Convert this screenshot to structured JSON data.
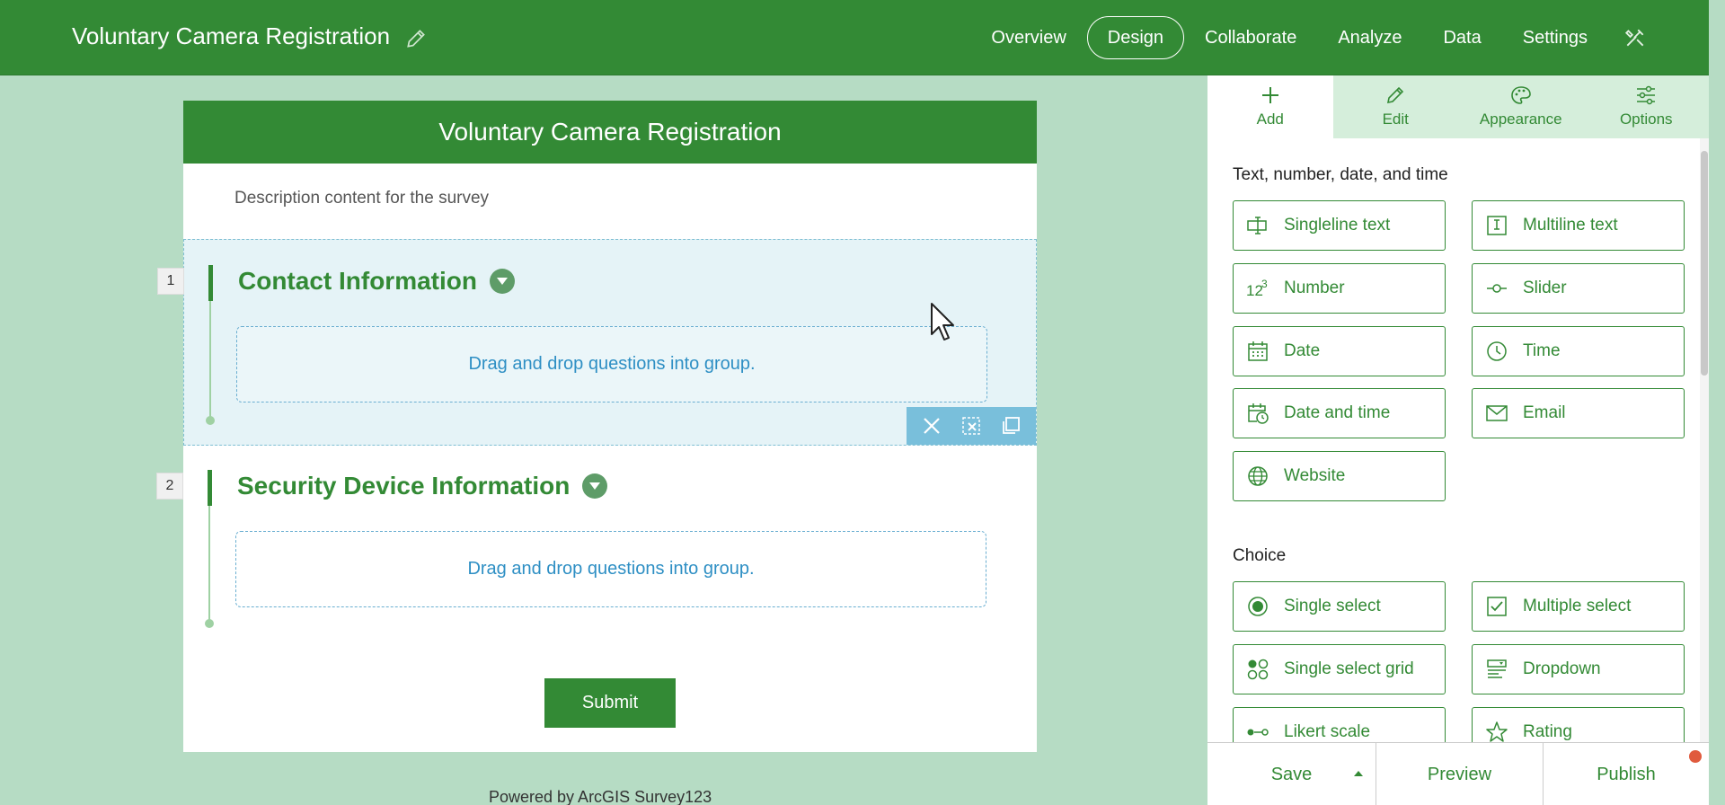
{
  "app": {
    "title": "Voluntary Camera Registration"
  },
  "nav": {
    "items": [
      {
        "label": "Overview",
        "active": false
      },
      {
        "label": "Design",
        "active": true
      },
      {
        "label": "Collaborate",
        "active": false
      },
      {
        "label": "Analyze",
        "active": false
      },
      {
        "label": "Data",
        "active": false
      },
      {
        "label": "Settings",
        "active": false
      }
    ]
  },
  "form": {
    "header": "Voluntary Camera Registration",
    "description": "Description content for the survey",
    "groups": [
      {
        "number": "1",
        "title": "Contact Information",
        "dropzone": "Drag and drop questions into group."
      },
      {
        "number": "2",
        "title": "Security Device Information",
        "dropzone": "Drag and drop questions into group."
      }
    ],
    "submit_label": "Submit",
    "powered_by": "Powered by ArcGIS Survey123"
  },
  "panel": {
    "tabs": [
      {
        "label": "Add",
        "icon": "plus-icon"
      },
      {
        "label": "Edit",
        "icon": "pencil-icon"
      },
      {
        "label": "Appearance",
        "icon": "palette-icon"
      },
      {
        "label": "Options",
        "icon": "sliders-icon"
      }
    ],
    "sections": [
      {
        "title": "Text, number, date, and time",
        "items": [
          {
            "label": "Singleline text",
            "icon": "singleline-text-icon"
          },
          {
            "label": "Multiline text",
            "icon": "multiline-text-icon"
          },
          {
            "label": "Number",
            "icon": "number-icon"
          },
          {
            "label": "Slider",
            "icon": "slider-icon"
          },
          {
            "label": "Date",
            "icon": "calendar-icon"
          },
          {
            "label": "Time",
            "icon": "clock-icon"
          },
          {
            "label": "Date and time",
            "icon": "calendar-clock-icon"
          },
          {
            "label": "Email",
            "icon": "envelope-icon"
          },
          {
            "label": "Website",
            "icon": "globe-icon"
          }
        ]
      },
      {
        "title": "Choice",
        "items": [
          {
            "label": "Single select",
            "icon": "radio-icon"
          },
          {
            "label": "Multiple select",
            "icon": "checkbox-icon"
          },
          {
            "label": "Single select grid",
            "icon": "grid-icon"
          },
          {
            "label": "Dropdown",
            "icon": "dropdown-icon"
          },
          {
            "label": "Likert scale",
            "icon": "likert-icon"
          },
          {
            "label": "Rating",
            "icon": "star-icon"
          }
        ]
      }
    ],
    "footer": {
      "save": "Save",
      "preview": "Preview",
      "publish": "Publish"
    }
  },
  "colors": {
    "brand_green": "#338a35",
    "canvas_bg": "#b6dcc4",
    "dropzone_blue": "#2e8fc4",
    "notify_red": "#e05a3d"
  }
}
